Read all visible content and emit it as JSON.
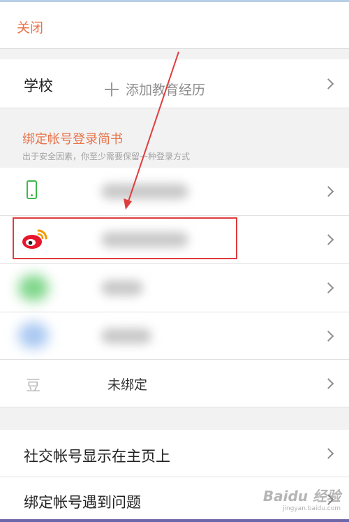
{
  "header": {
    "close_label": "关闭"
  },
  "school": {
    "label": "学校",
    "add_text": "添加教育经历"
  },
  "bind_section": {
    "title": "绑定帐号登录简书",
    "subtitle": "出于安全因素，你至少需要保留一种登录方式"
  },
  "accounts": {
    "douban_icon": "豆",
    "douban_status": "未绑定"
  },
  "settings": {
    "social_display": "社交帐号显示在主页上",
    "bind_problem": "绑定帐号遇到问题"
  },
  "icons": {
    "phone": "phone-icon",
    "weibo": "weibo-icon",
    "douban": "douban-icon",
    "chevron": "chevron-right-icon"
  },
  "colors": {
    "accent": "#e8734a",
    "phone_green": "#3eb84a",
    "weibo_red": "#e6162d",
    "highlight_red": "#e03c3c"
  }
}
